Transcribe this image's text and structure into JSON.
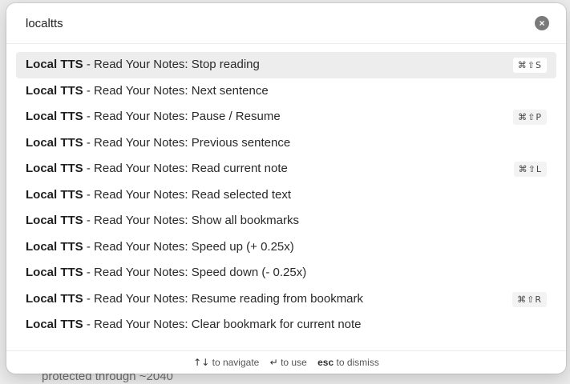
{
  "background": {
    "text": "protected through ~2040"
  },
  "search": {
    "value": "localtts",
    "clear_icon": "×"
  },
  "results": [
    {
      "plugin": "Local TTS",
      "command": " - Read Your Notes: Stop reading",
      "hotkey": "⌘⇧S",
      "selected": true
    },
    {
      "plugin": "Local TTS",
      "command": " - Read Your Notes: Next sentence",
      "hotkey": ""
    },
    {
      "plugin": "Local TTS",
      "command": " - Read Your Notes: Pause / Resume",
      "hotkey": "⌘⇧P"
    },
    {
      "plugin": "Local TTS",
      "command": " - Read Your Notes: Previous sentence",
      "hotkey": ""
    },
    {
      "plugin": "Local TTS",
      "command": " - Read Your Notes: Read current note",
      "hotkey": "⌘⇧L"
    },
    {
      "plugin": "Local TTS",
      "command": " - Read Your Notes: Read selected text",
      "hotkey": ""
    },
    {
      "plugin": "Local TTS",
      "command": " - Read Your Notes: Show all bookmarks",
      "hotkey": ""
    },
    {
      "plugin": "Local TTS",
      "command": " - Read Your Notes: Speed up (+ 0.25x)",
      "hotkey": ""
    },
    {
      "plugin": "Local TTS",
      "command": " - Read Your Notes: Speed down (- 0.25x)",
      "hotkey": ""
    },
    {
      "plugin": "Local TTS",
      "command": " - Read Your Notes: Resume reading from bookmark",
      "hotkey": "⌘⇧R"
    },
    {
      "plugin": "Local TTS",
      "command": " - Read Your Notes: Clear bookmark for current note",
      "hotkey": ""
    }
  ],
  "footer": {
    "navigate_key": "↑↓",
    "navigate_label": "to navigate",
    "use_key": "↵",
    "use_label": "to use",
    "dismiss_key": "esc",
    "dismiss_label": "to dismiss"
  }
}
